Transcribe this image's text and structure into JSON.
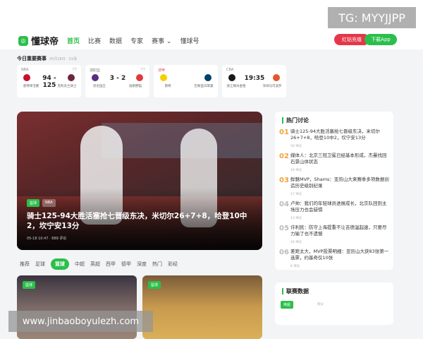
{
  "watermark_top": "TG: MYYJJPP",
  "watermark_bottom": "www.jinbaoboyulezh.com",
  "logo": {
    "mark": "◎",
    "text": "懂球帝"
  },
  "nav": {
    "items": [
      {
        "label": "首页",
        "active": true
      },
      {
        "label": "比赛",
        "active": false
      },
      {
        "label": "数据",
        "active": false
      },
      {
        "label": "专家",
        "active": false
      },
      {
        "label": "赛事 ⌄",
        "active": false
      },
      {
        "label": "懂球号",
        "active": false
      }
    ]
  },
  "header_buttons": {
    "recharge": "红钻充值",
    "download": "下载App"
  },
  "today": {
    "title": "今日重要赛事",
    "date": "05月18日 · 31场",
    "matches": [
      {
        "league": "NBA",
        "flag": "FT",
        "score": "94 - 125",
        "team1": "底特律活塞",
        "team2": "克利夫兰骑士",
        "c1": "#c8102e",
        "c2": "#6f263d"
      },
      {
        "league": "澳职篮",
        "flag": "FT",
        "score": "3 - 2",
        "team1": "悉尼国王",
        "team2": "珀斯野猫",
        "c1": "#5a2d81",
        "c2": "#e03a3e"
      },
      {
        "league": "法甲",
        "flag": "",
        "score": "",
        "team1": "南特",
        "team2": "巴黎圣日耳曼",
        "c1": "#f5d000",
        "c2": "#004170"
      },
      {
        "league": "CBA",
        "flag": "",
        "score": "19:35",
        "team1": "浙江稠州金租",
        "team2": "深圳马可波罗",
        "c1": "#1a1a1a",
        "c2": "#e4572e"
      }
    ]
  },
  "hero": {
    "tags": [
      "篮球",
      "NBA"
    ],
    "title": "骑士125-94大胜活塞抢七晋级东决，米切尔26+7+8，哈登10中2，坎宁安13分",
    "meta": "05-18 10:47 · 889 评论"
  },
  "filters": [
    "推荐",
    "足球",
    "篮球",
    "中超",
    "英超",
    "西甲",
    "德甲",
    "深度",
    "热门",
    "彩经"
  ],
  "filters_active": 2,
  "cards": [
    {
      "tag": "篮球"
    },
    {
      "tag": "篮球"
    }
  ],
  "hot": {
    "title": "热门讨论",
    "items": [
      {
        "num": "01",
        "title": "骑士125-94大胜活塞抢七晋级东决，米切尔26+7+8，哈登10中2，坎宁安13分",
        "count": "50 评论"
      },
      {
        "num": "02",
        "title": "媒体人：北京三冠卫冕已经基本形成，杰曼找回石景山体状态",
        "count": "19 评论"
      },
      {
        "num": "03",
        "title": "鲜魅MVP，Shams：亚历山大来赛季多项数据创造历史级别纪录",
        "count": "17 评论"
      },
      {
        "num": "04",
        "title": "卢帅：我们的年轻球员进展成长，北京队回到主场压力也会疑惧",
        "count": "13 评论"
      },
      {
        "num": "05",
        "title": "许利民：防守上海提重不让吉德温起速，只要尽力输了也不遗憾",
        "count": "16 评论"
      },
      {
        "num": "06",
        "title": "差距太大，MVP投票明细：亚历山大获83张第一选票，约基奇仅10张",
        "count": "8 评论"
      }
    ]
  },
  "league_panel": {
    "title": "联赛数据",
    "tag": "英超",
    "col": "积分"
  }
}
